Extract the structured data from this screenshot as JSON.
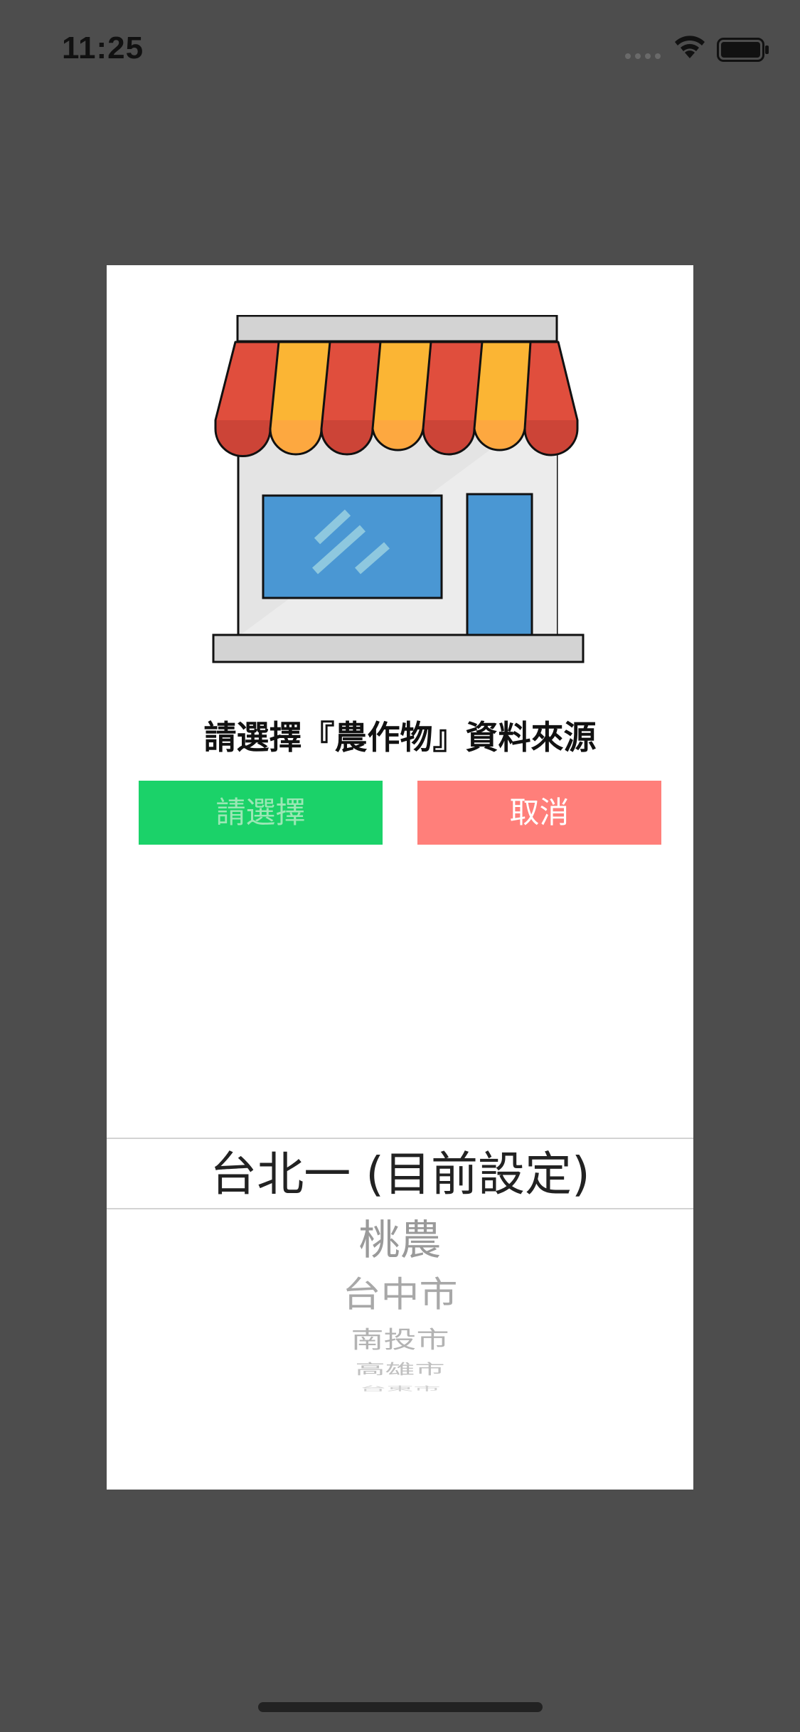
{
  "status_bar": {
    "time": "11:25",
    "icons": [
      "cellular-signal-icon",
      "wifi-icon",
      "battery-icon"
    ]
  },
  "dialog": {
    "illustration": "store-icon",
    "title": "請選擇『農作物』資料來源",
    "select_button_label": "請選擇",
    "cancel_button_label": "取消",
    "colors": {
      "select_button": "#1bd269",
      "cancel_button": "#ff7f7a",
      "background_dim": "#4d4d4d"
    }
  },
  "picker": {
    "selected": "台北一 (目前設定)",
    "options": [
      "桃農",
      "台中市",
      "南投市",
      "高雄市",
      "台東市"
    ]
  }
}
